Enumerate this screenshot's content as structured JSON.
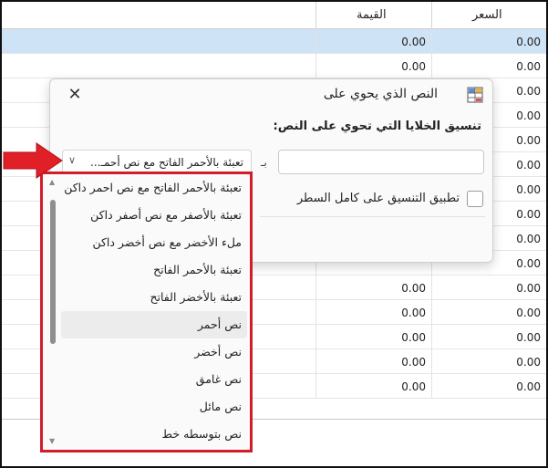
{
  "table": {
    "headers": {
      "price": "السعر",
      "value": "القيمة"
    },
    "rows": [
      {
        "price": "0.00",
        "value": "0.00"
      },
      {
        "price": "0.00",
        "value": "0.00"
      },
      {
        "price": "0.00",
        "value": ""
      },
      {
        "price": "0.00",
        "value": ""
      },
      {
        "price": "0.00",
        "value": ""
      },
      {
        "price": "0.00",
        "value": ""
      },
      {
        "price": "0.00",
        "value": ""
      },
      {
        "price": "0.00",
        "value": ""
      },
      {
        "price": "0.00",
        "value": ""
      },
      {
        "price": "0.00",
        "value": ""
      },
      {
        "price": "0.00",
        "value": "0.00"
      },
      {
        "price": "0.00",
        "value": "0.00"
      },
      {
        "price": "0.00",
        "value": "0.00"
      },
      {
        "price": "0.00",
        "value": "0.00"
      },
      {
        "price": "0.00",
        "value": "0.00"
      }
    ]
  },
  "dialog": {
    "title": "النص الذي يحوي على",
    "close_symbol": "✕",
    "label": "تنسيق الخلايا التي تحوي على النص:",
    "input_value": "",
    "mid_label": "بـ",
    "combo_selected": "تعبئة بالأحمر الفاتح مع نص أحمـ...",
    "checkbox_label": "تطبيق التنسيق على كامل السطر"
  },
  "dropdown": {
    "items": [
      "تعبئة بالأحمر الفاتح مع نص احمر داكن",
      "تعبئة بالأصفر مع نص أصفر داكن",
      "ملء الأخضر مع نص أخضر داكن",
      "تعبئة بالأحمر الفاتح",
      "تعبئة بالأخضر الفاتح",
      "نص أحمر",
      "نص أخضر",
      "نص غامق",
      "نص مائل",
      "نص بتوسطه خط"
    ],
    "hover_index": 5
  },
  "icons": {
    "dialog_icon": "grid-format-icon",
    "close": "close-icon",
    "chevron": "chevron-down-icon",
    "arrow": "red-arrow-pointer"
  },
  "colors": {
    "selected_row": "#cfe3f7",
    "highlight_border": "#d21c2a",
    "arrow": "#e01f26"
  }
}
